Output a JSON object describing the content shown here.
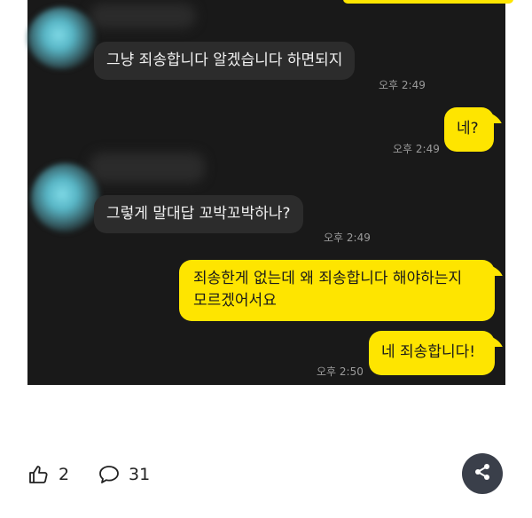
{
  "messages": [
    {
      "text": "그냥 죄송합니다 알겠습니다 하면되지",
      "time": "오후 2:49",
      "side": "in"
    },
    {
      "text": "네?",
      "time": "오후 2:49",
      "side": "out"
    },
    {
      "text": "그렇게 말대답 꼬박꼬박하나?",
      "time": "오후 2:49",
      "side": "in"
    },
    {
      "text_line1": "죄송한게 없는데 왜 죄송합니다 해야하는지",
      "text_line2": "모르겠어서요",
      "side": "out"
    },
    {
      "text": "네 죄송합니다!",
      "time": "오후 2:50",
      "side": "out"
    }
  ],
  "footer": {
    "like_count": "2",
    "comment_count": "31",
    "icons": [
      "thumbs-up-icon",
      "comment-icon",
      "share-icon"
    ]
  },
  "colors": {
    "chat_bg": "#191919",
    "incoming_bubble": "#2c2c2c",
    "outgoing_bubble": "#fee500",
    "share_button": "#3a3f4a"
  }
}
